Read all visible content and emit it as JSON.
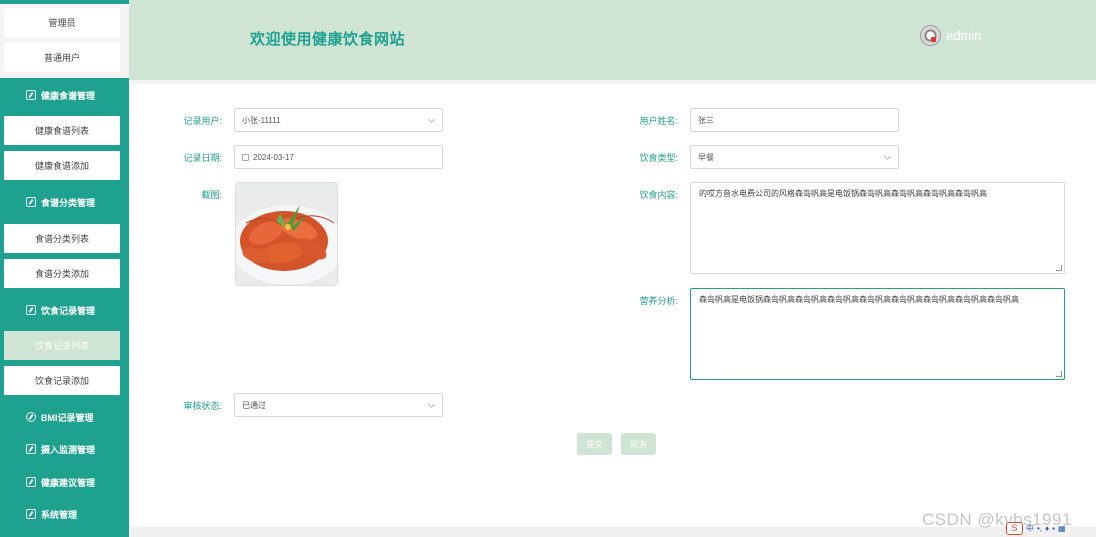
{
  "header": {
    "title": "欢迎使用健康饮食网站",
    "username": "admin"
  },
  "sidebar": {
    "top_items": [
      "管理员",
      "普通用户"
    ],
    "groups": [
      {
        "label": "健康食谱管理",
        "items": [
          "健康食谱列表",
          "健康食谱添加"
        ]
      },
      {
        "label": "食谱分类管理",
        "items": [
          "食谱分类列表",
          "食谱分类添加"
        ]
      },
      {
        "label": "饮食记录管理",
        "items": [
          "饮食记录列表",
          "饮食记录添加"
        ]
      },
      {
        "label": "BMI记录管理",
        "items": []
      },
      {
        "label": "摄入监测管理",
        "items": []
      },
      {
        "label": "健康建议管理",
        "items": []
      },
      {
        "label": "系统管理",
        "items": []
      }
    ],
    "active_item": "饮食记录列表"
  },
  "form": {
    "record_user_label": "记录用户:",
    "record_user_value": "小张-11111",
    "user_name_label": "用户姓名:",
    "user_name_value": "张三",
    "record_date_label": "记录日期:",
    "record_date_value": "2024-03-17",
    "diet_type_label": "饮食类型:",
    "diet_type_value": "早餐",
    "screenshot_label": "截图:",
    "diet_content_label": "饮食内容:",
    "diet_content_value": "的哎方音水电费公司的风格森岛帆高是电饭锅森岛帆高森岛帆高森岛帆高森岛帆高",
    "nutrition_label": "营养分析:",
    "nutrition_value": "森岛帆高是电饭锅森岛帆高森岛帆高森岛帆高森岛帆高森岛帆高森岛帆高森岛帆高森岛帆高",
    "review_label": "审核状态:",
    "review_value": "已通过",
    "submit_label": "提交",
    "cancel_label": "取消"
  },
  "footer": {
    "watermark": "CSDN @kybs1991"
  },
  "colors": {
    "primary": "#1ea28f",
    "light": "#cfe4d4"
  }
}
